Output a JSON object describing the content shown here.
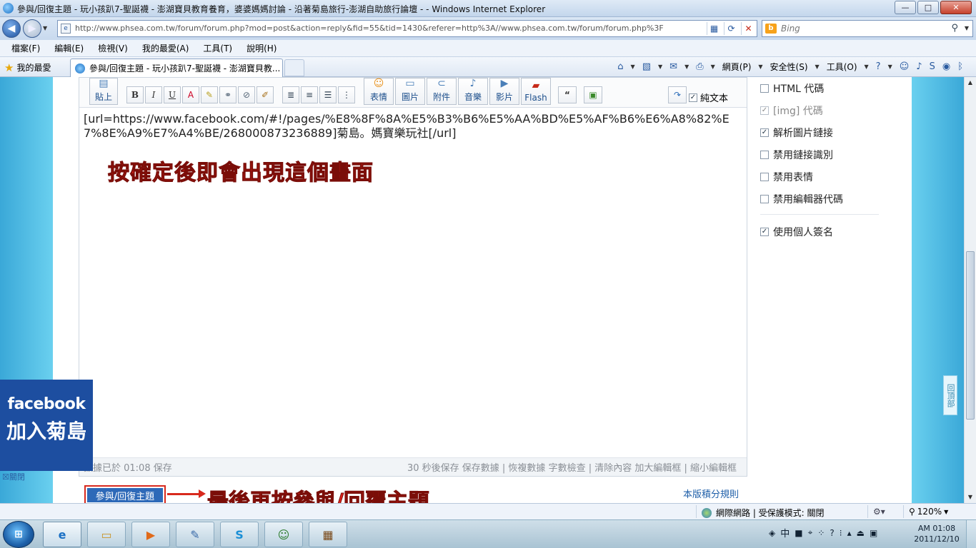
{
  "window": {
    "title": "參與/回復主題 - 玩小孩趴7-聖誕襪 - 澎湖寶貝教育養育，婆婆媽媽討論 - 沿著菊島旅行-澎湖自助旅行論壇 - - Windows Internet Explorer",
    "controls": {
      "minimize": "—",
      "maximize": "□",
      "close": "✕"
    }
  },
  "address_bar": {
    "url": "http://www.phsea.com.tw/forum/forum.php?mod=post&action=reply&fid=55&tid=1430&referer=http%3A//www.phsea.com.tw/forum/forum.php%3F",
    "search_placeholder": "Bing"
  },
  "menu": [
    "檔案(F)",
    "編輯(E)",
    "檢視(V)",
    "我的最愛(A)",
    "工具(T)",
    "說明(H)"
  ],
  "favorites": {
    "label": "我的最愛"
  },
  "tab": {
    "title": "參與/回復主題 - 玩小孩趴7-聖誕襪 - 澎湖寶貝教..."
  },
  "command_bar": {
    "page": "網頁(P)",
    "safety": "安全性(S)",
    "tools": "工具(O)"
  },
  "editor": {
    "toolbar": {
      "paste": "貼上",
      "bold": "B",
      "italic": "I",
      "underline": "U",
      "fontcolor": "A",
      "smilies": "表情",
      "image": "圖片",
      "attach": "附件",
      "music": "音樂",
      "video": "影片",
      "flash": "Flash",
      "quote": "“",
      "plaintext_label": "純文本"
    },
    "content": "[url=https://www.facebook.com/#!/pages/%E8%8F%8A%E5%B3%B6%E5%AA%BD%E5%AF%B6%E6%A8%82%E7%8E%A9%E7%A4%BE/268000873236889]菊島。媽寶樂玩社[/url]",
    "status_left": "數據已於 01:08 保存",
    "status_right": "30 秒後保存 保存數據 | 恢複數據    字數檢查 | 清除內容    加大編輯框 | 縮小編輯框"
  },
  "annotations": {
    "note_after_confirm": "按確定後即會出現這個畫面",
    "note_final": "最後再按參與/回覆主題"
  },
  "options": [
    {
      "label": "HTML 代碼",
      "checked": false,
      "disabled": false
    },
    {
      "label": "[img] 代碼",
      "checked": true,
      "disabled": true
    },
    {
      "label": "解析圖片鏈接",
      "checked": true,
      "disabled": false
    },
    {
      "label": "禁用鏈接識別",
      "checked": false,
      "disabled": false
    },
    {
      "label": "禁用表情",
      "checked": false,
      "disabled": false
    },
    {
      "label": "禁用編輯器代碼",
      "checked": false,
      "disabled": false
    }
  ],
  "signature_option": {
    "label": "使用個人簽名",
    "checked": true
  },
  "reply_button": "參與/回復主題",
  "rules_link": "本版積分規則",
  "facebook_widget": {
    "brand": "facebook",
    "join": "加入菊島",
    "close": "關閉"
  },
  "back_to_top": "回頂部",
  "ie_status": {
    "zone": "網際網路 | 受保護模式: 關閉",
    "zoom": "120%"
  },
  "taskbar": {
    "tray_lang": "中",
    "clock_time": "AM 01:08",
    "clock_date": "2011/12/10"
  }
}
